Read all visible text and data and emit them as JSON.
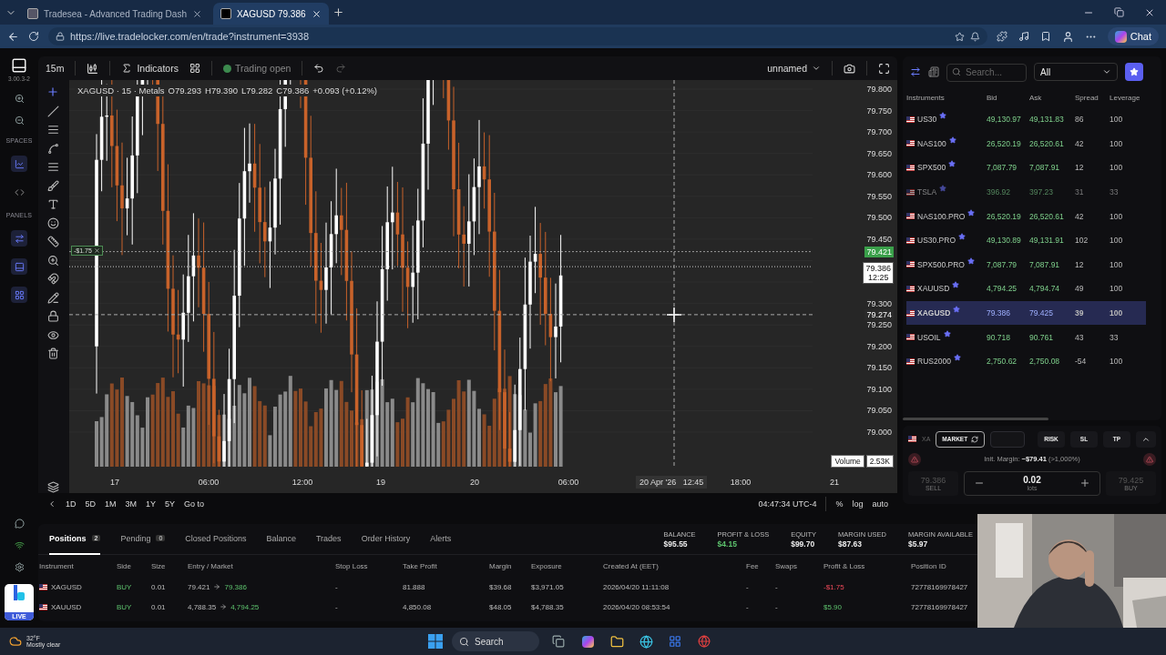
{
  "browser": {
    "tabs": [
      {
        "title": "Tradesea - Advanced Trading Dash",
        "selected": false
      },
      {
        "title": "XAGUSD 79.386",
        "selected": true
      }
    ],
    "url": "https://live.tradelocker.com/en/trade?instrument=3938",
    "chat_label": "Chat"
  },
  "rail": {
    "version": "3.00.3-2",
    "spaces_label": "SPACES",
    "panels_label": "PANELS",
    "live_label": "LIVE"
  },
  "toolbar": {
    "timeframe": "15m",
    "indicators": "Indicators",
    "status": "Trading open",
    "layout": "unnamed"
  },
  "chart": {
    "legend": {
      "title": "XAGUSD · 15 · Metals",
      "ohlc": [
        {
          "key": "O",
          "value": "79.293"
        },
        {
          "key": "H",
          "value": "79.390"
        },
        {
          "key": "L",
          "value": "79.282"
        },
        {
          "key": "C",
          "value": "79.386"
        }
      ],
      "change": "+0.093 (+0.12%)"
    },
    "price_ticks": [
      "79.800",
      "79.750",
      "79.700",
      "79.650",
      "79.600",
      "79.550",
      "79.500",
      "79.450",
      "79.300",
      "79.250",
      "79.200",
      "79.150",
      "79.100",
      "79.050",
      "79.000"
    ],
    "position_price": "79.421",
    "position_tag": "-$1.75",
    "current_price": "79.386",
    "countdown": "12:25",
    "crosshair_price": "79.274",
    "time_ticks": [
      "17",
      "06:00",
      "12:00",
      "19",
      "20",
      "06:00",
      "18:00",
      "21"
    ],
    "crosshair_date": "20 Apr '26",
    "crosshair_time": "12:45",
    "volume_label": "Volume",
    "volume_value": "2.53K"
  },
  "range_bar": {
    "ranges": [
      "1D",
      "5D",
      "1M",
      "3M",
      "1Y",
      "5Y"
    ],
    "goto": "Go to",
    "clock": "04:47:34 UTC-4",
    "options": [
      "%",
      "log",
      "auto"
    ]
  },
  "instruments": {
    "search_placeholder": "Search...",
    "filter": "All",
    "columns": [
      "Instruments",
      "Bid",
      "Ask",
      "Spread",
      "Leverage"
    ],
    "rows": [
      {
        "name": "US30",
        "bid": "49,130.97",
        "ask": "49,131.83",
        "spread": "86",
        "leverage": "100",
        "favorite": true,
        "disabled": false,
        "selected": false
      },
      {
        "name": "NAS100",
        "bid": "26,520.19",
        "ask": "26,520.61",
        "spread": "42",
        "leverage": "100",
        "favorite": true,
        "disabled": false,
        "selected": false
      },
      {
        "name": "SPX500",
        "bid": "7,087.79",
        "ask": "7,087.91",
        "spread": "12",
        "leverage": "100",
        "favorite": true,
        "disabled": false,
        "selected": false
      },
      {
        "name": "TSLA",
        "bid": "396.92",
        "ask": "397.23",
        "spread": "31",
        "leverage": "33",
        "favorite": true,
        "disabled": true,
        "selected": false
      },
      {
        "name": "NAS100.PRO",
        "bid": "26,520.19",
        "ask": "26,520.61",
        "spread": "42",
        "leverage": "100",
        "favorite": true,
        "disabled": false,
        "selected": false
      },
      {
        "name": "US30.PRO",
        "bid": "49,130.89",
        "ask": "49,131.91",
        "spread": "102",
        "leverage": "100",
        "favorite": true,
        "disabled": false,
        "selected": false
      },
      {
        "name": "SPX500.PRO",
        "bid": "7,087.79",
        "ask": "7,087.91",
        "spread": "12",
        "leverage": "100",
        "favorite": true,
        "disabled": false,
        "selected": false
      },
      {
        "name": "XAUUSD",
        "bid": "4,794.25",
        "ask": "4,794.74",
        "spread": "49",
        "leverage": "100",
        "favorite": true,
        "disabled": false,
        "selected": false
      },
      {
        "name": "XAGUSD",
        "bid": "79.386",
        "ask": "79.425",
        "spread": "39",
        "leverage": "100",
        "favorite": true,
        "disabled": false,
        "selected": true
      },
      {
        "name": "USOIL",
        "bid": "90.718",
        "ask": "90.761",
        "spread": "43",
        "leverage": "33",
        "favorite": true,
        "disabled": false,
        "selected": false
      },
      {
        "name": "RUS2000",
        "bid": "2,750.62",
        "ask": "2,750.08",
        "spread": "-54",
        "leverage": "100",
        "favorite": true,
        "disabled": false,
        "selected": false
      }
    ]
  },
  "order": {
    "symbol": "XA",
    "type": "MARKET",
    "buttons": [
      "RISK",
      "SL",
      "TP"
    ],
    "margin": "Init. Margin: **~$79.41** (>1,000%)",
    "sell_price": "79.386",
    "sell_label": "SELL",
    "lots": "0.02",
    "lots_label": "lots",
    "buy_price": "79.425",
    "buy_label": "BUY"
  },
  "positions": {
    "tabs": [
      {
        "label": "Positions",
        "count": "2",
        "selected": true
      },
      {
        "label": "Pending",
        "count": "0",
        "selected": false
      },
      {
        "label": "Closed Positions",
        "selected": false
      },
      {
        "label": "Balance",
        "selected": false
      },
      {
        "label": "Trades",
        "selected": false
      },
      {
        "label": "Order History",
        "selected": false
      },
      {
        "label": "Alerts",
        "selected": false
      }
    ],
    "stats": [
      {
        "label": "BALANCE",
        "value": "$95.55",
        "positive": false
      },
      {
        "label": "PROFIT & LOSS",
        "value": "$4.15",
        "positive": true
      },
      {
        "label": "EQUITY",
        "value": "$99.70",
        "positive": false
      },
      {
        "label": "MARGIN USED",
        "value": "$87.63",
        "positive": false
      },
      {
        "label": "MARGIN AVAILABLE",
        "value": "$5.97",
        "positive": false
      }
    ],
    "columns": [
      "Instrument",
      "Side",
      "Size",
      "Entry / Market",
      "Stop Loss",
      "Take Profit",
      "Margin",
      "Exposure",
      "Created At (EET)",
      "Fee",
      "Swaps",
      "Profit & Loss",
      "Position ID"
    ],
    "rows": [
      {
        "instrument": "XAGUSD",
        "side": "BUY",
        "size": "0.01",
        "entry": "79.421",
        "market": "79.386",
        "stop_loss": "-",
        "take_profit": "81.888",
        "margin": "$39.68",
        "exposure": "$3,971.05",
        "created": "2026/04/20 11:11:08",
        "fee": "-",
        "swaps": "-",
        "pnl": "-$1.75",
        "profit": false,
        "position_id": "72778169978427"
      },
      {
        "instrument": "XAUUSD",
        "side": "BUY",
        "size": "0.01",
        "entry": "4,788.35",
        "market": "4,794.25",
        "stop_loss": "-",
        "take_profit": "4,850.08",
        "margin": "$48.05",
        "exposure": "$4,788.35",
        "created": "2026/04/20 08:53:54",
        "fee": "-",
        "swaps": "-",
        "pnl": "$5.90",
        "profit": true,
        "position_id": "72778169978427"
      }
    ]
  },
  "taskbar": {
    "temperature": "32°F",
    "weather": "Mostly clear",
    "search": "Search"
  }
}
